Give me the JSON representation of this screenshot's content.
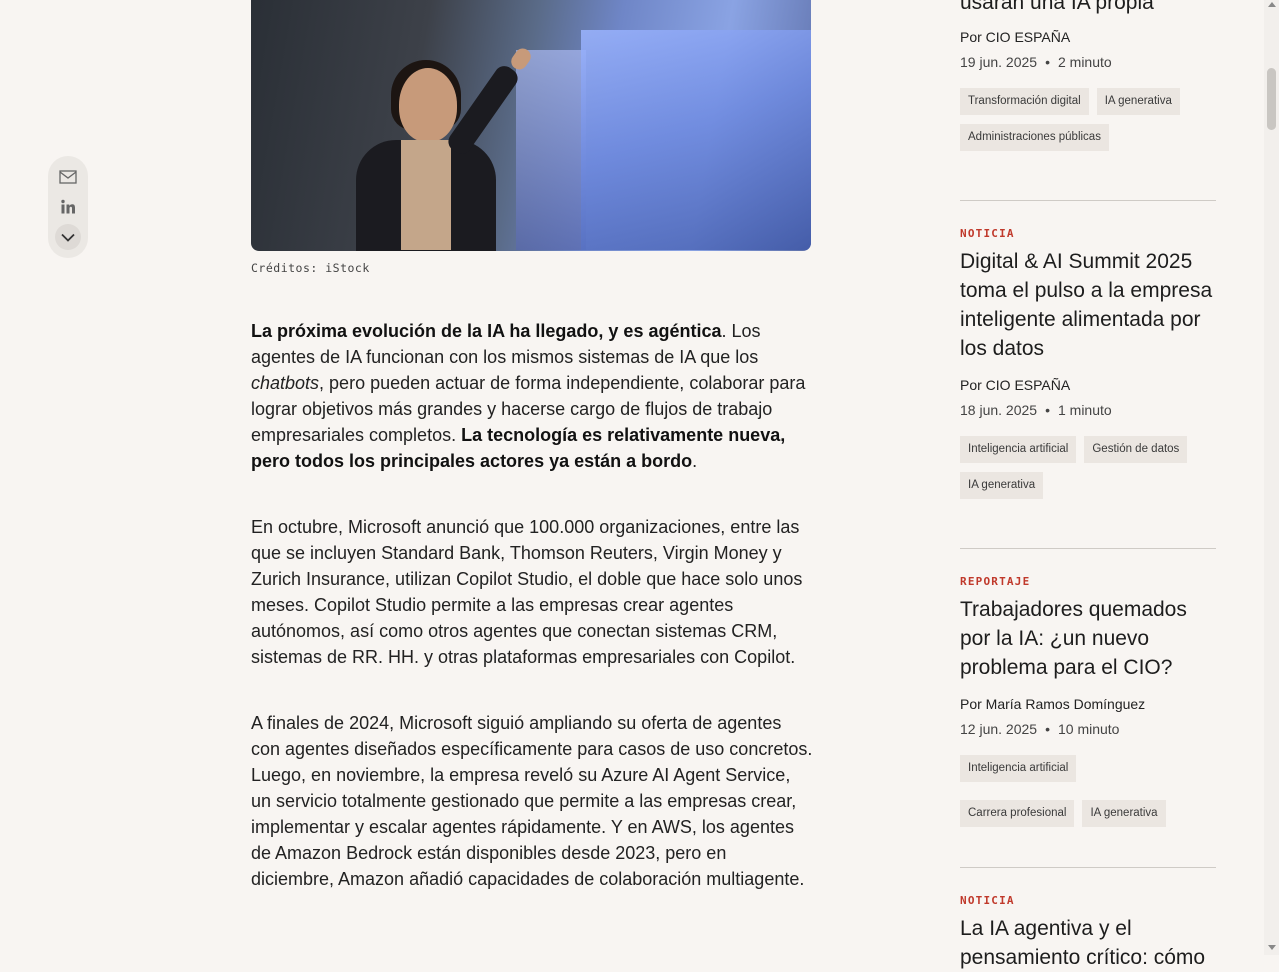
{
  "share": {
    "icons": [
      "mail-icon",
      "linkedin-icon",
      "chevron-down-icon"
    ]
  },
  "hero": {
    "caption": "Créditos: iStock"
  },
  "article": {
    "p1": {
      "bold1": "La próxima evolución de la IA ha llegado, y es agéntica",
      "t1": ". Los agentes de IA funcionan con los mismos sistemas de IA que los ",
      "italic": "chatbots",
      "t2": ", pero pueden actuar de forma independiente, colaborar para lograr objetivos más grandes y hacerse cargo de flujos de trabajo empresariales completos. ",
      "bold2": "La tecnología es relativamente nueva, pero todos los principales actores ya están a bordo",
      "t3": "."
    },
    "p2": "En octubre, Microsoft anunció que 100.000 organizaciones, entre las que se incluyen Standard Bank, Thomson Reuters, Virgin Money y Zurich Insurance, utilizan Copilot Studio, el doble que hace solo unos meses. Copilot Studio permite a las empresas crear agentes autónomos, así como otros agentes que conectan sistemas CRM, sistemas de RR. HH. y otras plataformas empresariales con Copilot.",
    "p3": "A finales de 2024, Microsoft siguió ampliando su oferta de agentes con agentes diseñados específicamente para casos de uso concretos. Luego, en noviembre, la empresa reveló su Azure AI Agent Service, un servicio totalmente gestionado que permite a las empresas crear, implementar y escalar agentes rápidamente. Y en AWS, los agentes de Amazon Bedrock están disponibles desde 2023, pero en diciembre, Amazon añadió capacidades de colaboración multiagente."
  },
  "sidebar": {
    "card0": {
      "title_partial": "usarán una IA propia",
      "byline": "Por CIO ESPAÑA",
      "date": "19 jun. 2025",
      "read": "2 minuto",
      "tags": [
        "Transformación digital",
        "IA generativa",
        "Administraciones públicas"
      ]
    },
    "card1": {
      "kicker": "NOTICIA",
      "title": "Digital & AI Summit 2025 toma el pulso a la empresa inteligente alimentada por los datos",
      "byline": "Por CIO ESPAÑA",
      "date": "18 jun. 2025",
      "read": "1 minuto",
      "tags": [
        "Inteligencia artificial",
        "Gestión de datos",
        "IA generativa"
      ]
    },
    "card2": {
      "kicker": "REPORTAJE",
      "title": "Trabajadores quemados por la IA: ¿un nuevo problema para el CIO?",
      "byline": "Por María Ramos Domínguez",
      "date": "12 jun. 2025",
      "read": "10 minuto",
      "tags": [
        "Inteligencia artificial",
        "Carrera profesional",
        "IA generativa"
      ]
    },
    "card3": {
      "kicker": "NOTICIA",
      "title_partial": "La IA agentiva y el pensamiento crítico: cómo"
    }
  }
}
